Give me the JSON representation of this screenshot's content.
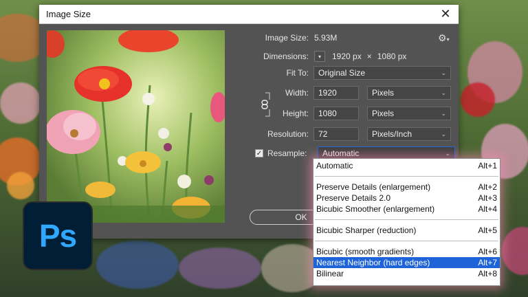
{
  "dialog": {
    "title": "Image Size",
    "image_size_label": "Image Size:",
    "image_size_value": "5.93M",
    "dimensions_label": "Dimensions:",
    "dimensions_width": "1920 px",
    "dimensions_times": "×",
    "dimensions_height": "1080 px",
    "fit_to_label": "Fit To:",
    "fit_to_value": "Original Size",
    "width_label": "Width:",
    "width_value": "1920",
    "width_unit": "Pixels",
    "height_label": "Height:",
    "height_value": "1080",
    "height_unit": "Pixels",
    "resolution_label": "Resolution:",
    "resolution_value": "72",
    "resolution_unit": "Pixels/Inch",
    "resample_label": "Resample:",
    "resample_value": "Automatic",
    "ok_label": "OK"
  },
  "resample_menu": {
    "groups": [
      [
        {
          "label": "Automatic",
          "shortcut": "Alt+1"
        }
      ],
      [
        {
          "label": "Preserve Details (enlargement)",
          "shortcut": "Alt+2"
        },
        {
          "label": "Preserve Details 2.0",
          "shortcut": "Alt+3"
        },
        {
          "label": "Bicubic Smoother (enlargement)",
          "shortcut": "Alt+4"
        }
      ],
      [
        {
          "label": "Bicubic Sharper (reduction)",
          "shortcut": "Alt+5"
        }
      ],
      [
        {
          "label": "Bicubic (smooth gradients)",
          "shortcut": "Alt+6"
        },
        {
          "label": "Nearest Neighbor (hard edges)",
          "shortcut": "Alt+7",
          "selected": true
        },
        {
          "label": "Bilinear",
          "shortcut": "Alt+8"
        }
      ]
    ]
  },
  "logo": {
    "text": "Ps"
  },
  "colors": {
    "accent": "#1e64d8",
    "ps_blue": "#31a8ff",
    "ps_bg": "#001e36",
    "dialog_bg": "#535353"
  }
}
